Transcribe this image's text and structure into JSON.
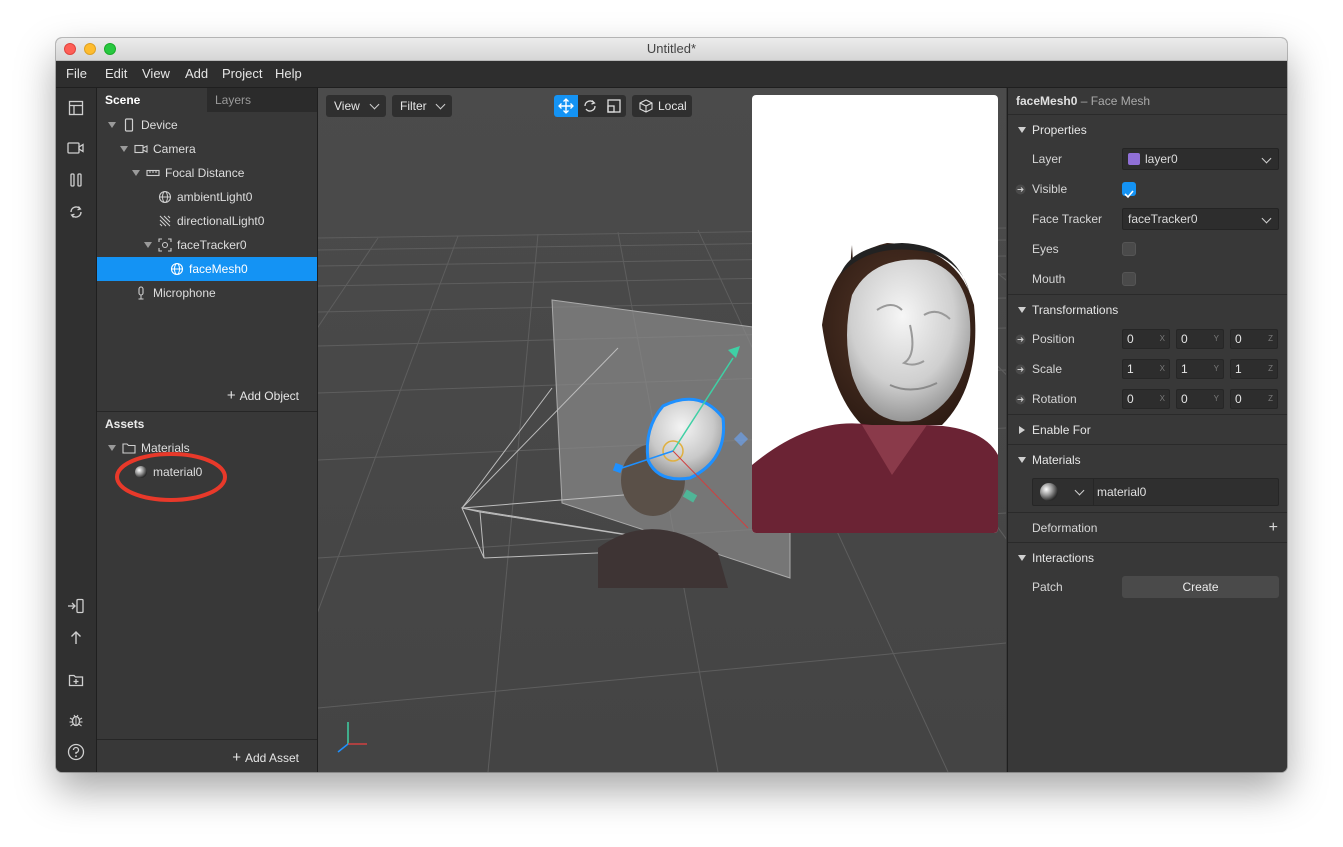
{
  "window": {
    "title": "Untitled*"
  },
  "menu": [
    "File",
    "Edit",
    "View",
    "Add",
    "Project",
    "Help"
  ],
  "left": {
    "tabs": {
      "scene": "Scene",
      "layers": "Layers"
    },
    "tree": [
      {
        "label": "Device"
      },
      {
        "label": "Camera"
      },
      {
        "label": "Focal Distance"
      },
      {
        "label": "ambientLight0"
      },
      {
        "label": "directionalLight0"
      },
      {
        "label": "faceTracker0"
      },
      {
        "label": "faceMesh0"
      },
      {
        "label": "Microphone"
      }
    ],
    "add_object": "Add Object",
    "assets": {
      "title": "Assets",
      "folder": "Materials",
      "item": "material0",
      "add_asset": "Add Asset"
    }
  },
  "viewport": {
    "view_label": "View",
    "filter_label": "Filter",
    "local_label": "Local"
  },
  "inspector": {
    "object_name": "faceMesh0",
    "object_type": " – Face Mesh",
    "properties_title": "Properties",
    "layer_label": "Layer",
    "layer_value": "layer0",
    "layer_color": "#8f6fd6",
    "visible_label": "Visible",
    "face_tracker_label": "Face Tracker",
    "face_tracker_value": "faceTracker0",
    "eyes_label": "Eyes",
    "mouth_label": "Mouth",
    "transformations_title": "Transformations",
    "position_label": "Position",
    "scale_label": "Scale",
    "rotation_label": "Rotation",
    "position": [
      "0",
      "0",
      "0"
    ],
    "scale": [
      "1",
      "1",
      "1"
    ],
    "rotation": [
      "0",
      "0",
      "0"
    ],
    "axes": [
      "X",
      "Y",
      "Z"
    ],
    "enable_for_title": "Enable For",
    "materials_title": "Materials",
    "material_value": "material0",
    "deformation_label": "Deformation",
    "interactions_title": "Interactions",
    "patch_label": "Patch",
    "create_label": "Create",
    "accent": "#1493f4"
  }
}
